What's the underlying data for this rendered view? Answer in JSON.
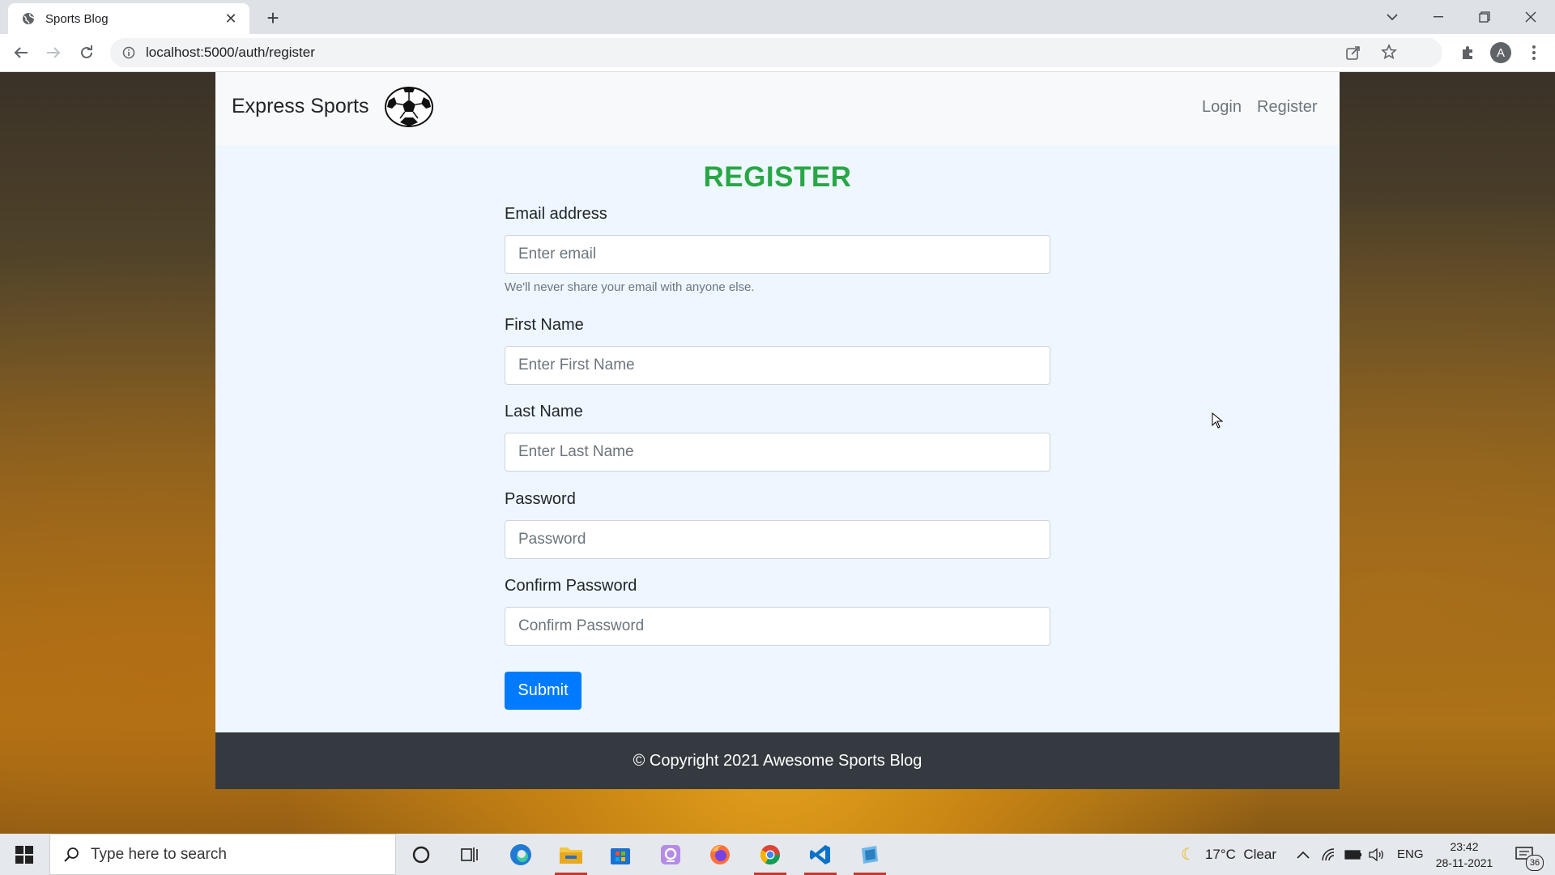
{
  "browser": {
    "tab_title": "Sports Blog",
    "url": "localhost:5000/auth/register",
    "profile_initial": "A"
  },
  "navbar": {
    "brand": "Express Sports",
    "links": [
      "Login",
      "Register"
    ]
  },
  "register": {
    "heading": "REGISTER",
    "email": {
      "label": "Email address",
      "placeholder": "Enter email",
      "help": "We'll never share your email with anyone else."
    },
    "first_name": {
      "label": "First Name",
      "placeholder": "Enter First Name"
    },
    "last_name": {
      "label": "Last Name",
      "placeholder": "Enter Last Name"
    },
    "password": {
      "label": "Password",
      "placeholder": "Password"
    },
    "confirm_password": {
      "label": "Confirm Password",
      "placeholder": "Confirm Password"
    },
    "submit_label": "Submit"
  },
  "footer": {
    "text": "© Copyright 2021 Awesome Sports Blog"
  },
  "taskbar": {
    "search_placeholder": "Type here to search",
    "weather": "17°C  Clear",
    "language": "ENG",
    "time": "23:42",
    "date": "28-11-2021",
    "notification_count": "36"
  },
  "colors": {
    "heading": "#28a745",
    "button": "#007bff",
    "footer_bg": "#343a40",
    "content_bg": "#eef7ff"
  }
}
